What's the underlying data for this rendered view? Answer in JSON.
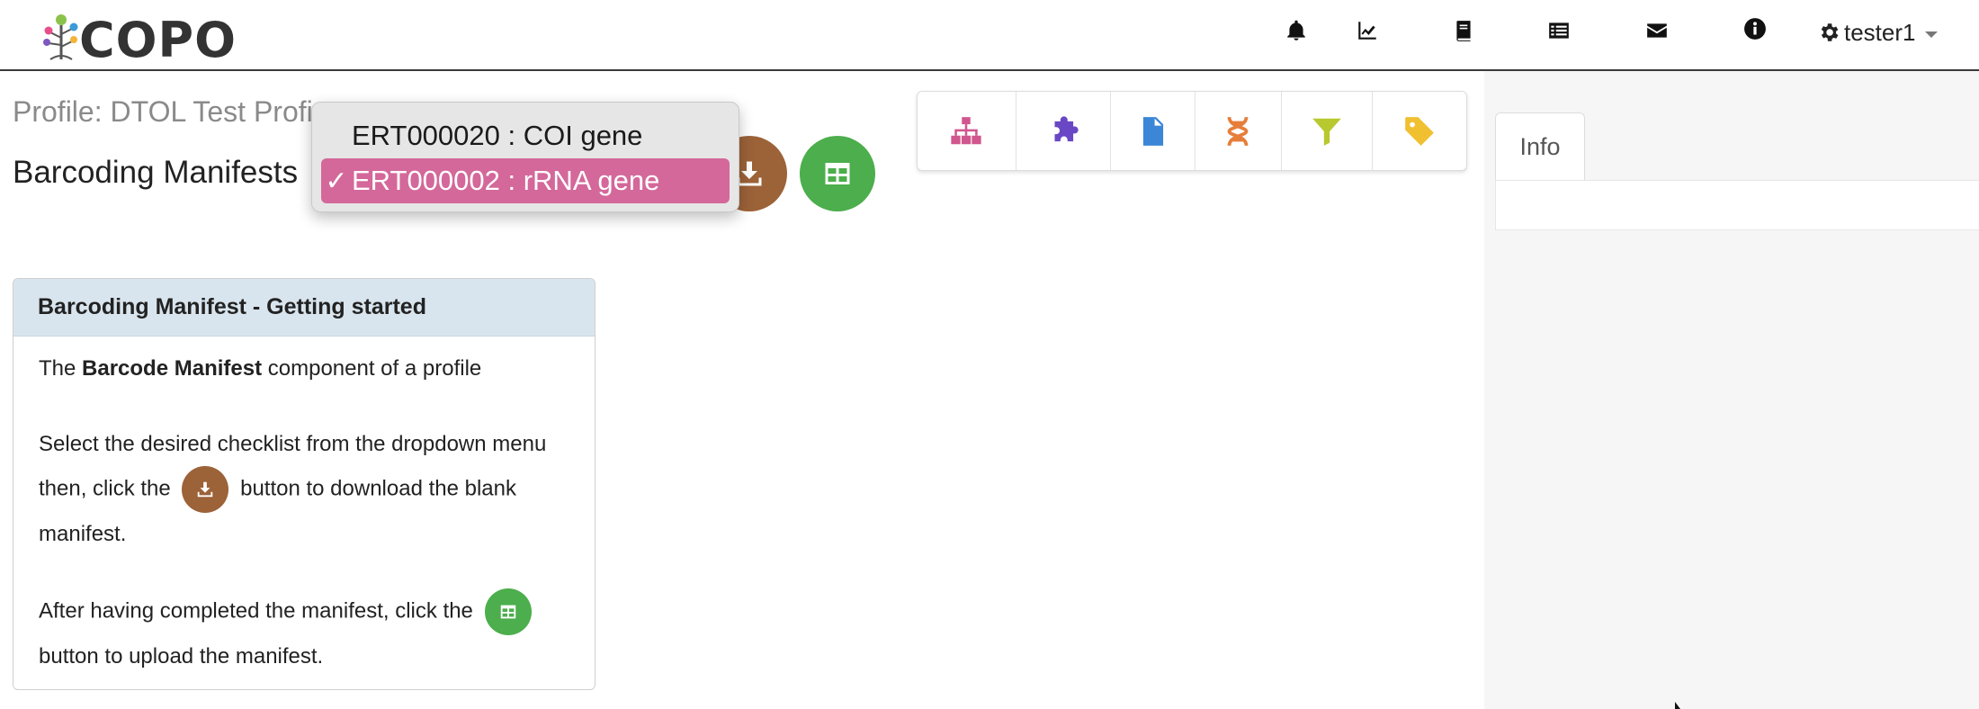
{
  "navbar": {
    "brand": "COPO",
    "icons": [
      "bell-icon",
      "chart-line-icon",
      "book-icon",
      "list-alt-icon",
      "envelope-icon",
      "info-circle-icon"
    ],
    "user": {
      "name": "tester1",
      "icon": "gear-icon"
    }
  },
  "header": {
    "profile_title": "Profile: DTOL Test Profi",
    "page_title": "Barcoding Manifests"
  },
  "dropdown": {
    "options": [
      {
        "label": "ERT000020 : COI gene",
        "selected": false
      },
      {
        "label": "ERT000002 : rRNA gene",
        "selected": true
      }
    ],
    "check_mark": "✓",
    "highlight_color": "#d4689a"
  },
  "action_buttons": {
    "download_color": "#9c6238",
    "upload_color": "#4cae4c"
  },
  "toolbar": {
    "tools": [
      {
        "icon": "sitemap-icon",
        "color": "#d0568e"
      },
      {
        "icon": "puzzle-piece-icon",
        "color": "#6a47c4"
      },
      {
        "icon": "file-icon",
        "color": "#3b86d6"
      },
      {
        "icon": "dna-icon",
        "color": "#e67e3a"
      },
      {
        "icon": "filter-icon",
        "color": "#b7c92e"
      },
      {
        "icon": "tag-icon",
        "color": "#f0c030"
      }
    ]
  },
  "info_panel": {
    "tab_label": "Info"
  },
  "help": {
    "title": "Barcoding Manifest - Getting started",
    "p1_prefix": "The ",
    "p1_bold": "Barcode Manifest",
    "p1_suffix": " component of a profile",
    "p2_line1": "Select the desired checklist from the dropdown menu",
    "p2_before_icon": "then, click the",
    "p2_after_icon": "button to download the blank manifest.",
    "p3_before_icon": "After having completed the manifest, click the",
    "p3_after_icon": "button to upload the manifest."
  }
}
